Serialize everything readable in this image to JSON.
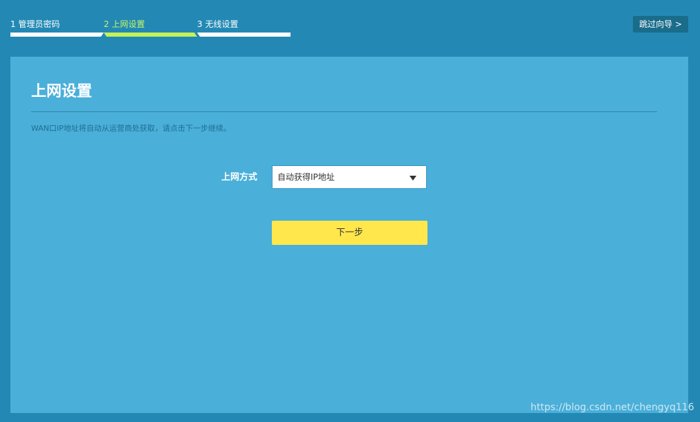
{
  "steps": [
    {
      "label": "1 管理员密码"
    },
    {
      "label": "2 上网设置"
    },
    {
      "label": "3 无线设置"
    }
  ],
  "skip_label": "跳过向导 >",
  "panel": {
    "title": "上网设置",
    "hint": "WAN口IP地址将自动从运营商处获取，请点击下一步继续。",
    "field_label": "上网方式",
    "select_value": "自动获得IP地址",
    "next_label": "下一步"
  },
  "watermark": "https://blog.csdn.net/chengyq116",
  "colors": {
    "background": "#2389b4",
    "panel": "#4aafd9",
    "active_step": "#c3f25a",
    "next_button": "#ffe74c"
  }
}
